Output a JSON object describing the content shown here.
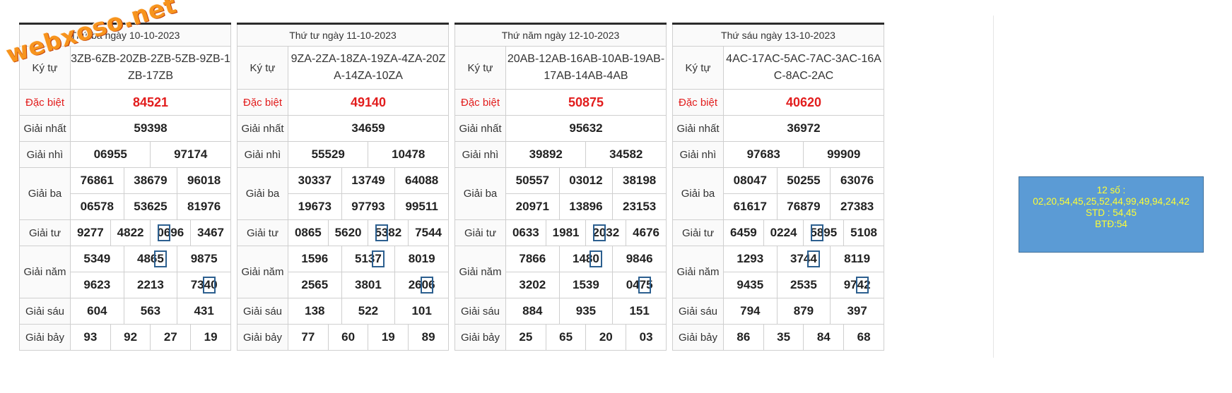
{
  "logo": "webxoso.net",
  "labels": {
    "kytu": "Ký tự",
    "db": "Đặc biệt",
    "g1": "Giải nhất",
    "g2": "Giải nhì",
    "g3": "Giải ba",
    "g4": "Giải tư",
    "g5": "Giải năm",
    "g6": "Giải sáu",
    "g7": "Giải bảy"
  },
  "days": [
    {
      "header": "Thứ ba ngày 10-10-2023",
      "kytu": "3ZB-6ZB-20ZB-2ZB-5ZB-9ZB-1ZB-17ZB",
      "db": "84521",
      "g1": "59398",
      "g2": [
        "06955",
        "97174"
      ],
      "g3": [
        "76861",
        "38679",
        "96018",
        "06578",
        "53625",
        "81976"
      ],
      "g4": [
        "9277",
        "4822",
        "0696",
        "3467"
      ],
      "g5": [
        "5349",
        "4865",
        "9875",
        "9623",
        "2213",
        "7340"
      ],
      "g6": [
        "604",
        "563",
        "431"
      ],
      "g7": [
        "93",
        "92",
        "27",
        "19"
      ]
    },
    {
      "header": "Thứ tư ngày 11-10-2023",
      "kytu": "9ZA-2ZA-18ZA-19ZA-4ZA-20ZA-14ZA-10ZA",
      "db": "49140",
      "g1": "34659",
      "g2": [
        "55529",
        "10478"
      ],
      "g3": [
        "30337",
        "13749",
        "64088",
        "19673",
        "97793",
        "99511"
      ],
      "g4": [
        "0865",
        "5620",
        "5382",
        "7544"
      ],
      "g5": [
        "1596",
        "5137",
        "8019",
        "2565",
        "3801",
        "2606"
      ],
      "g6": [
        "138",
        "522",
        "101"
      ],
      "g7": [
        "77",
        "60",
        "19",
        "89"
      ]
    },
    {
      "header": "Thứ năm ngày 12-10-2023",
      "kytu": "20AB-12AB-16AB-10AB-19AB-17AB-14AB-4AB",
      "db": "50875",
      "g1": "95632",
      "g2": [
        "39892",
        "34582"
      ],
      "g3": [
        "50557",
        "03012",
        "38198",
        "20971",
        "13896",
        "23153"
      ],
      "g4": [
        "0633",
        "1981",
        "2032",
        "4676"
      ],
      "g5": [
        "7866",
        "1480",
        "9846",
        "3202",
        "1539",
        "0475"
      ],
      "g6": [
        "884",
        "935",
        "151"
      ],
      "g7": [
        "25",
        "65",
        "20",
        "03"
      ]
    },
    {
      "header": "Thứ sáu ngày 13-10-2023",
      "kytu": "4AC-17AC-5AC-7AC-3AC-16AC-8AC-2AC",
      "db": "40620",
      "g1": "36972",
      "g2": [
        "97683",
        "99909"
      ],
      "g3": [
        "08047",
        "50255",
        "63076",
        "61617",
        "76879",
        "27383"
      ],
      "g4": [
        "6459",
        "0224",
        "5895",
        "5108"
      ],
      "g5": [
        "1293",
        "3744",
        "8119",
        "9435",
        "2535",
        "9742"
      ],
      "g6": [
        "794",
        "879",
        "397"
      ],
      "g7": [
        "86",
        "35",
        "84",
        "68"
      ]
    }
  ],
  "info": {
    "line1": "12 số :",
    "line2": "02,20,54,45,25,52,44,99,49,94,24,42",
    "line3": "STD : 54,45",
    "line4": "BTĐ:54"
  },
  "colors": {
    "special_prize": "#e21d1d",
    "box": "#5b9bd5",
    "box_text": "#ffff33",
    "highlight": "#2c5f8f"
  }
}
